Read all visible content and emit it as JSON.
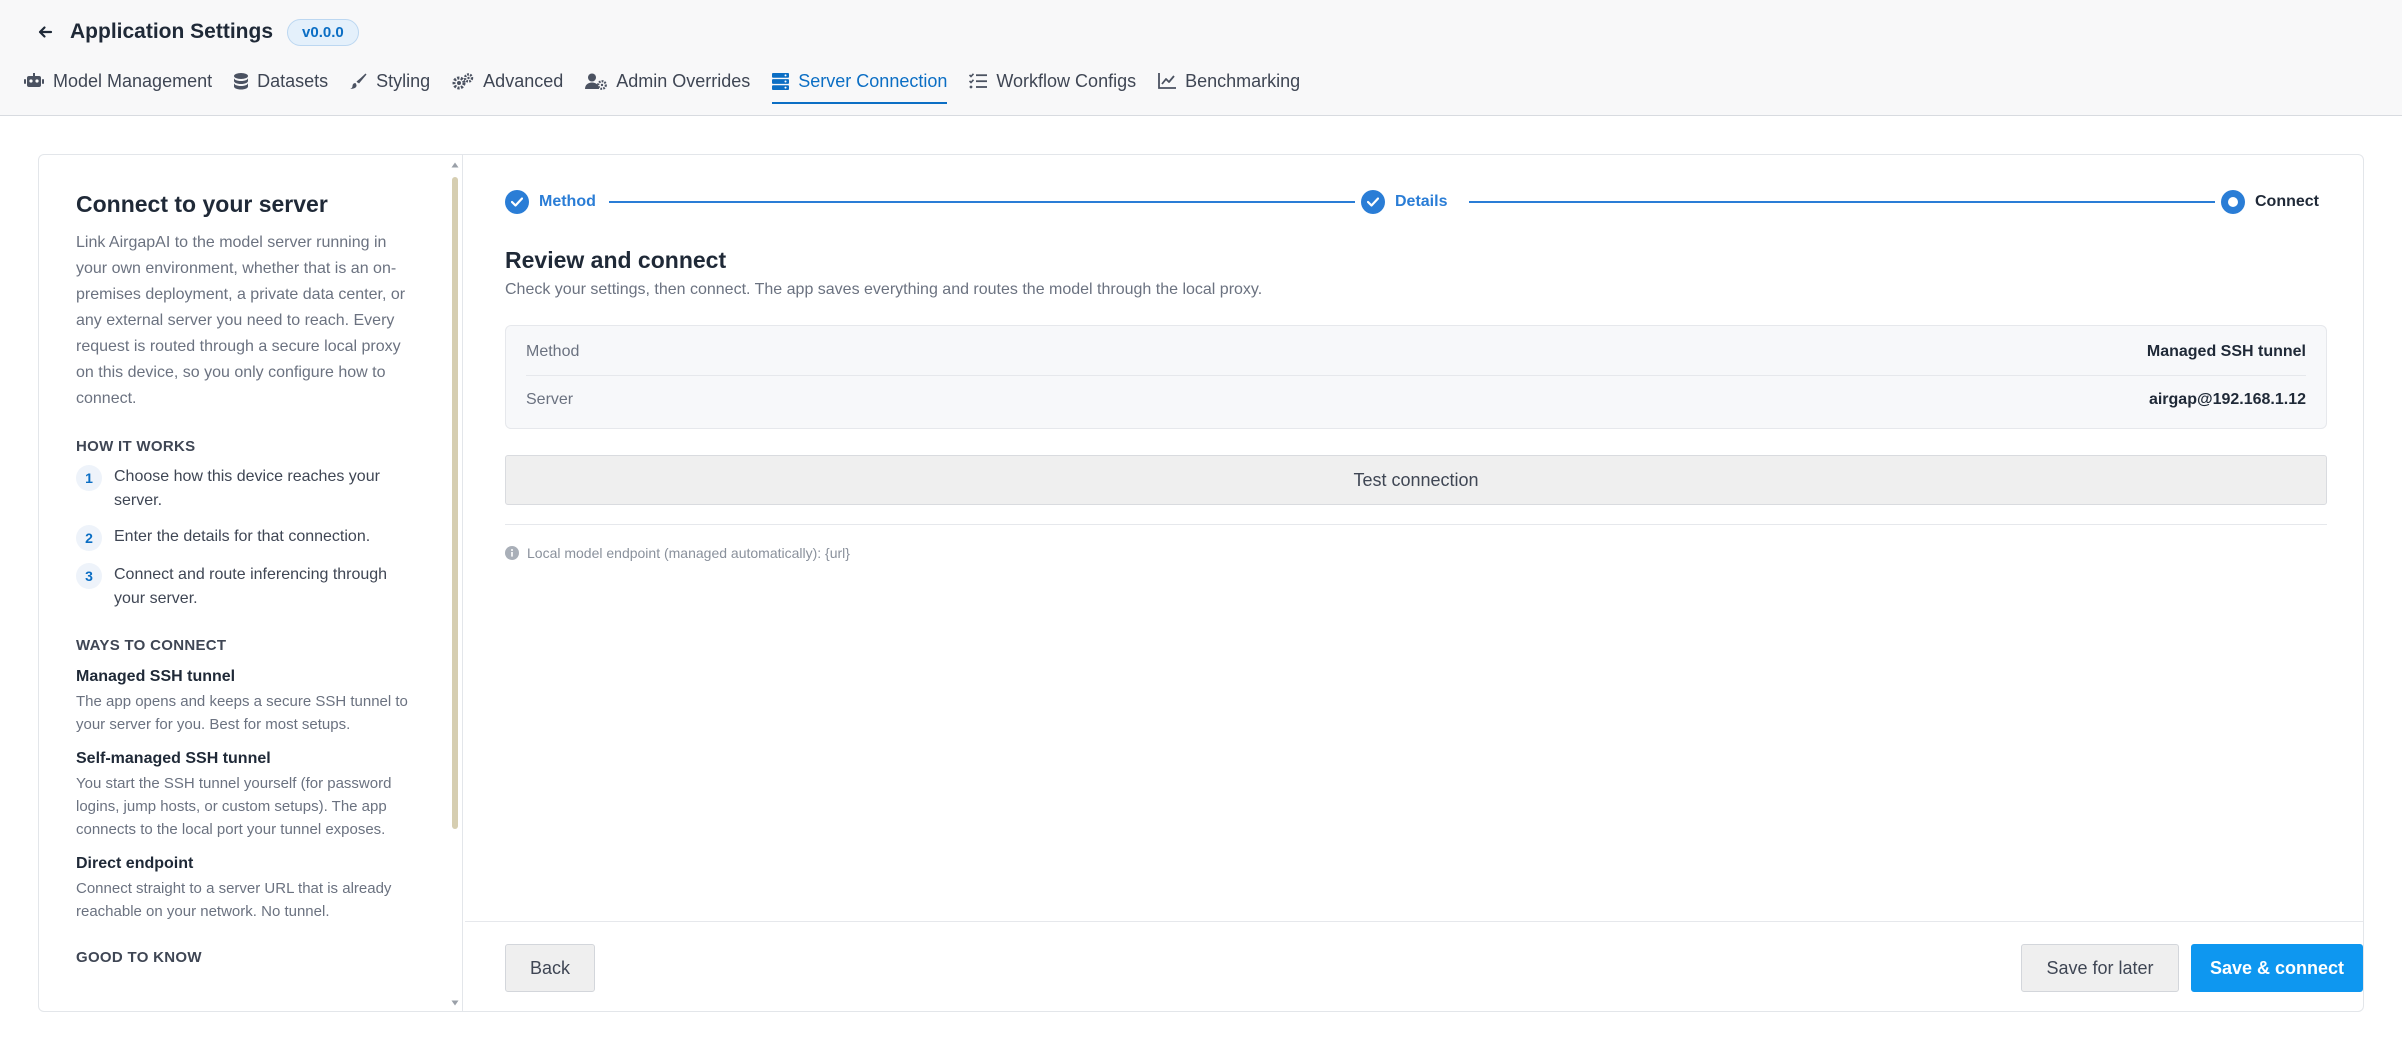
{
  "header": {
    "title": "Application Settings",
    "version": "v0.0.0",
    "tabs": [
      {
        "label": "Model Management",
        "icon": "robot-icon"
      },
      {
        "label": "Datasets",
        "icon": "database-icon"
      },
      {
        "label": "Styling",
        "icon": "brush-icon"
      },
      {
        "label": "Advanced",
        "icon": "gears-icon"
      },
      {
        "label": "Admin Overrides",
        "icon": "user-gear-icon"
      },
      {
        "label": "Server Connection",
        "icon": "server-icon",
        "active": true
      },
      {
        "label": "Workflow Configs",
        "icon": "list-check-icon"
      },
      {
        "label": "Benchmarking",
        "icon": "chart-line-icon"
      }
    ]
  },
  "sidebar": {
    "title": "Connect to your server",
    "intro": "Link AirgapAI to the model server running in your own environment, whether that is an on-premises deployment, a private data center, or any external server you need to reach. Every request is routed through a secure local proxy on this device, so you only configure how to connect.",
    "how_it_works_heading": "HOW IT WORKS",
    "steps": [
      {
        "num": "1",
        "text": "Choose how this device reaches your server."
      },
      {
        "num": "2",
        "text": "Enter the details for that connection."
      },
      {
        "num": "3",
        "text": "Connect and route inferencing through your server."
      }
    ],
    "ways_heading": "WAYS TO CONNECT",
    "ways": [
      {
        "title": "Managed SSH tunnel",
        "desc": "The app opens and keeps a secure SSH tunnel to your server for you. Best for most setups."
      },
      {
        "title": "Self-managed SSH tunnel",
        "desc": "You start the SSH tunnel yourself (for password logins, jump hosts, or custom setups). The app connects to the local port your tunnel exposes."
      },
      {
        "title": "Direct endpoint",
        "desc": "Connect straight to a server URL that is already reachable on your network. No tunnel."
      }
    ],
    "good_to_know_heading": "GOOD TO KNOW"
  },
  "stepper": {
    "steps": [
      {
        "label": "Method",
        "state": "complete"
      },
      {
        "label": "Details",
        "state": "complete"
      },
      {
        "label": "Connect",
        "state": "current"
      }
    ]
  },
  "review": {
    "title": "Review and connect",
    "subtitle": "Check your settings, then connect. The app saves everything and routes the model through the local proxy.",
    "rows": [
      {
        "label": "Method",
        "value": "Managed SSH tunnel"
      },
      {
        "label": "Server",
        "value": "airgap@192.168.1.12"
      }
    ],
    "test_button": "Test connection",
    "endpoint_note": "Local model endpoint (managed automatically): {url}"
  },
  "footer": {
    "back": "Back",
    "save_later": "Save for later",
    "save_connect": "Save & connect"
  },
  "colors": {
    "accent": "#0b6ec4",
    "stepper": "#2a7dd6",
    "primary_button": "#0e97f0",
    "scroll_thumb": "#d6ceb1"
  }
}
